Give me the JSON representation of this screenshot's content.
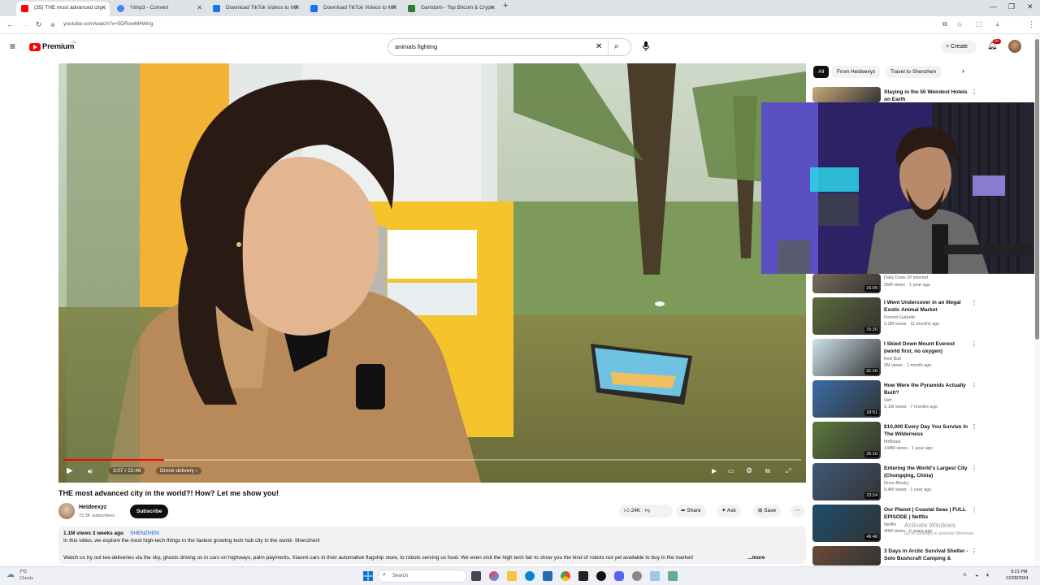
{
  "browser": {
    "tabs": [
      {
        "label": "(35) THE most advanced city",
        "active": true,
        "color": "#ff0000"
      },
      {
        "label": "Ytmp3 - Convert",
        "active": false,
        "color": "#4285f4"
      },
      {
        "label": "Download TikTok Videos to MP",
        "active": false,
        "color": "#1a73e8"
      },
      {
        "label": "Download TikTok Videos to MP",
        "active": false,
        "color": "#1a73e8"
      },
      {
        "label": "Gamdom - Top Bitcoin & Crypt",
        "active": false,
        "color": "#2e7d32"
      }
    ],
    "new_tab": "+",
    "url": "youtube.com/watch?v=5DRowM4Wrig"
  },
  "youtube": {
    "logo_text": "Premium",
    "logo_sup": "CA",
    "search_value": "animals fighting",
    "create_label": "Create",
    "notif_count": "9+"
  },
  "player": {
    "time": "3:07 / 22:46",
    "chapter": "Drone delivery",
    "progress": 0.137
  },
  "video": {
    "title": "THE most advanced city in the world?! How? Let me show you!",
    "channel": "Heideexyz",
    "subscribers": "72.3K subscribers",
    "subscribe_label": "Subscribe",
    "likes": "24K",
    "share_label": "Share",
    "ask_label": "Ask",
    "save_label": "Save",
    "desc_views": "1.1M views  3 weeks ago",
    "desc_location": "SHENZHEN",
    "desc_line1": "In this video, we explore the most high-tech things in the fastest growing tech hub city in the world- Shenzhen!",
    "desc_line2": "Watch us try out tea deliveries via the sky, ghosts driving us in cars on highways, palm payments, Xiaomi cars in their automative flagship store, to robots serving us food. We even visit the high tech fair to show you the kind of robots not yet available to buy in the market!",
    "desc_more": "...more"
  },
  "chips": [
    "All",
    "From Heideexyz",
    "Travel to Shenzhen"
  ],
  "recommendations": [
    {
      "title": "Staying in the 50 Weirdest Hotels on Earth",
      "channel": "",
      "meta": "",
      "duration": "",
      "thumb": "#c9a97a"
    },
    {
      "title": "",
      "channel": "Daily Dose Of Internet",
      "meta": "35M views · 1 year ago",
      "duration": "16:09",
      "thumb": "#7a6a5a"
    },
    {
      "title": "I Went Undercover in an Illegal Exotic Animal Market",
      "channel": "Forrest Galante",
      "meta": "3.3M views · 11 months ago",
      "duration": "15:20",
      "thumb": "#5d6b3a"
    },
    {
      "title": "I Skied Down Mount Everest (world first, no oxygen)",
      "channel": "Red Bull",
      "meta": "2M views · 1 month ago",
      "duration": "31:16",
      "thumb": "#cfe3ef"
    },
    {
      "title": "How Were the Pyramids Actually Built?",
      "channel": "Veh",
      "meta": "3.1M views · 7 months ago",
      "duration": "18:51",
      "thumb": "#3a6ea5"
    },
    {
      "title": "$10,000 Every Day You Survive In The Wilderness",
      "channel": "MrBeast",
      "meta": "144M views · 1 year ago",
      "duration": "26:16",
      "thumb": "#5b7a3a"
    },
    {
      "title": "Entering the World's Largest City (Chongqing, China)",
      "channel": "Drew Binsky",
      "meta": "5.4M views · 1 year ago",
      "duration": "23:24",
      "thumb": "#3c5a7a"
    },
    {
      "title": "Our Planet | Coastal Seas | FULL EPISODE | Netflix",
      "channel": "Netflix",
      "meta": "40M views · 5 years ago",
      "duration": "49:48",
      "thumb": "#1c4e6e"
    },
    {
      "title": "3 Days in Arctic Survival Shelter - Solo Bushcraft Camping &",
      "channel": "",
      "meta": "",
      "duration": "",
      "thumb": "#6a4a3a"
    }
  ],
  "taskbar": {
    "weather_temp": "7°C",
    "weather_desc": "Cloudy",
    "search_label": "Search",
    "time": "9:21 PM",
    "date": "12/28/2024"
  },
  "watermark": {
    "line1": "Activate Windows",
    "line2": "Go to Settings to activate Windows."
  }
}
